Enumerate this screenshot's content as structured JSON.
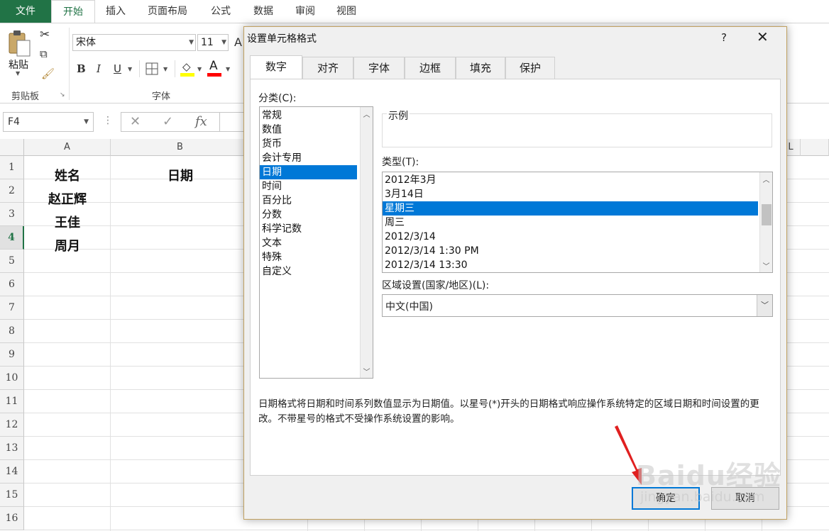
{
  "ribbon_tabs": [
    "文件",
    "开始",
    "插入",
    "页面布局",
    "公式",
    "数据",
    "审阅",
    "视图"
  ],
  "ribbon": {
    "paste_label": "粘贴",
    "clipboard_label": "剪贴板",
    "font_group_label": "字体",
    "font_name": "宋体",
    "font_size": "11",
    "bold": "B",
    "italic": "I",
    "underline": "U",
    "font_color_glyph": "A",
    "grow_glyph": "A",
    "fill_color": "#ffff00",
    "font_color": "#ff0000"
  },
  "formula_bar": {
    "name_box": "F4",
    "cancel_glyph": "✕",
    "enter_glyph": "✓",
    "fx": "fx"
  },
  "grid": {
    "columns": [
      "A",
      "B",
      "L"
    ],
    "rows": [
      "1",
      "2",
      "3",
      "4",
      "5",
      "6",
      "7",
      "8",
      "9",
      "10",
      "11",
      "12",
      "13",
      "14",
      "15",
      "16"
    ],
    "selected_row": "4",
    "cells": {
      "A1": "姓名",
      "B1": "日期",
      "A2": "赵正辉",
      "A3": "王佳",
      "A4": "周月"
    }
  },
  "dialog": {
    "title": "设置单元格格式",
    "help": "?",
    "close": "✕",
    "tabs": [
      "数字",
      "对齐",
      "字体",
      "边框",
      "填充",
      "保护"
    ],
    "active_tab": "数字",
    "category_label": "分类(C):",
    "categories": [
      "常规",
      "数值",
      "货币",
      "会计专用",
      "日期",
      "时间",
      "百分比",
      "分数",
      "科学记数",
      "文本",
      "特殊",
      "自定义"
    ],
    "selected_category": "日期",
    "sample_label": "示例",
    "sample_value": "",
    "type_label": "类型(T):",
    "types": [
      "2012年3月",
      "3月14日",
      "星期三",
      "周三",
      "2012/3/14",
      "2012/3/14 1:30 PM",
      "2012/3/14 13:30"
    ],
    "selected_type": "星期三",
    "locale_label": "区域设置(国家/地区)(L):",
    "locale_value": "中文(中国)",
    "description": "日期格式将日期和时间系列数值显示为日期值。以星号(*)开头的日期格式响应操作系统特定的区域日期和时间设置的更改。不带星号的格式不受操作系统设置的影响。",
    "ok_label": "确定",
    "cancel_label": "取消"
  },
  "watermark": {
    "brand": "Baidu经验",
    "url": "jingyan.baidu.com"
  },
  "annotation_arrow_color": "#e02020"
}
